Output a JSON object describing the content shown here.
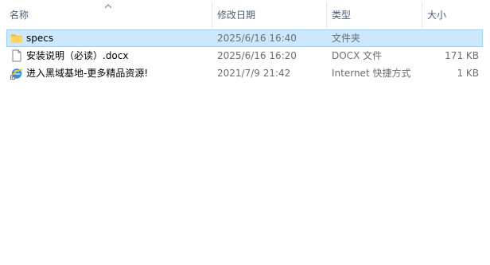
{
  "header": {
    "columns": {
      "name": "名称",
      "date": "修改日期",
      "type": "类型",
      "size": "大小"
    },
    "sort_column": "name",
    "sort_direction": "ascending"
  },
  "files": [
    {
      "name": "specs",
      "date": "2025/6/16 16:40",
      "type": "文件夹",
      "size": "",
      "icon": "folder-icon",
      "selected": true
    },
    {
      "name": "安装说明（必读）.docx",
      "date": "2025/6/16 16:20",
      "type": "DOCX 文件",
      "size": "171 KB",
      "icon": "document-icon",
      "selected": false
    },
    {
      "name": "进入黑域基地-更多精品资源!",
      "date": "2021/7/9 21:42",
      "type": "Internet 快捷方式",
      "size": "1 KB",
      "icon": "internet-shortcut-icon",
      "selected": false
    }
  ],
  "colors": {
    "selection_fill": "#cce8ff",
    "selection_border": "#99d1ff",
    "header_text": "#4c607a",
    "secondary_text": "#6d6d6d",
    "folder": "#ffd35c"
  }
}
